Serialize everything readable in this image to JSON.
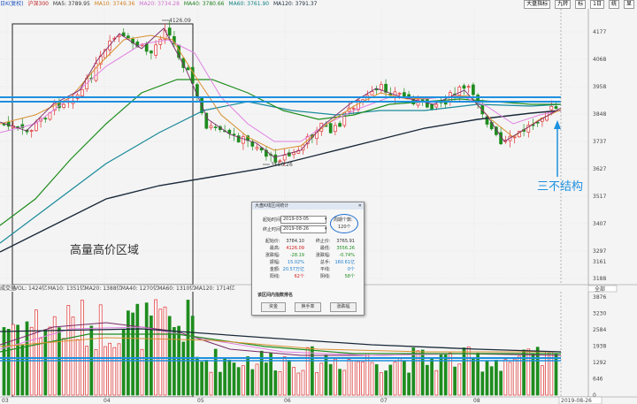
{
  "toolbar": {
    "index_name": "日K(复权)",
    "index_code": "沪深300",
    "ma_items": [
      {
        "label": "MA5: 3789.95",
        "color": "#333333"
      },
      {
        "label": "MA10: 3749.36",
        "color": "#d08020"
      },
      {
        "label": "MA20: 3734.28",
        "color": "#d070d0"
      },
      {
        "label": "MA40: 3780.66",
        "color": "#208020"
      },
      {
        "label": "MA60: 3761.90",
        "color": "#108080"
      },
      {
        "label": "MA120: 3791.37",
        "color": "#203040"
      }
    ],
    "right_buttons": [
      "大盘指标",
      "九转",
      "标",
      "1日",
      "统",
      "显"
    ]
  },
  "price_axis": [
    "4177",
    "4068",
    "3958",
    "3848",
    "3737",
    "3627",
    "3517",
    "3407",
    "3297",
    "3188",
    "3161"
  ],
  "volume_axis": [
    "3876",
    "3230",
    "2584",
    "1938",
    "1292",
    "646",
    "0"
  ],
  "time_axis": [
    "03",
    "04",
    "05",
    "06",
    "07",
    "08"
  ],
  "current_date": "2019-08-26",
  "volume_bar": {
    "title": "成交量",
    "items": [
      {
        "label": "VOL: 1424亿",
        "color": "#c02020"
      },
      {
        "label": "MA10: 1351亿",
        "color": "#d08020"
      },
      {
        "label": "MA20: 1388亿",
        "color": "#d070d0"
      },
      {
        "label": "MA40: 1270亿",
        "color": "#208020"
      },
      {
        "label": "MA60: 1310亿",
        "color": "#108080"
      },
      {
        "label": "MA120: 1714亿",
        "color": "#203040"
      }
    ],
    "right_select": "全部"
  },
  "annotations": {
    "high_price": "4126.09",
    "low_price": "3556.26",
    "high_vol_zone": "高量高价区域",
    "san_bu_jie_gou": "三不结构"
  },
  "dialog": {
    "title": "大盘K线区间统计",
    "start_label": "起始时间:",
    "start_value": "2019-03-05",
    "end_label": "终止时间:",
    "end_value": "2019-08-26",
    "period_label": "周期个数:",
    "period_value": "120个",
    "rows": [
      [
        "起始价:",
        "3784.10",
        "终止价:",
        "3765.91"
      ],
      [
        "最高:",
        "4126.09",
        "最低:",
        "3556.26"
      ],
      [
        "涨跌幅:",
        "-28.19",
        "涨跌幅:",
        "-0.74%"
      ],
      [
        "振幅:",
        "15.02%",
        "总手:",
        "160.61亿"
      ],
      [
        "金额:",
        "20.57万亿",
        "平线:",
        "0个"
      ],
      [
        "阳线:",
        "62个",
        "阴线:",
        "58个"
      ]
    ],
    "section_label": "该区间内指数排名",
    "buttons": [
      "资金",
      "换手率",
      "涨跌幅"
    ]
  },
  "colors": {
    "up": "#e03030",
    "down": "#1e8c1e",
    "blue_line": "#1e90e0",
    "ma120": "#1a2a3a",
    "ma60": "#1a8a9a",
    "ma40": "#1e8c1e",
    "ma20": "#e080e0",
    "ma10": "#d89030"
  }
}
